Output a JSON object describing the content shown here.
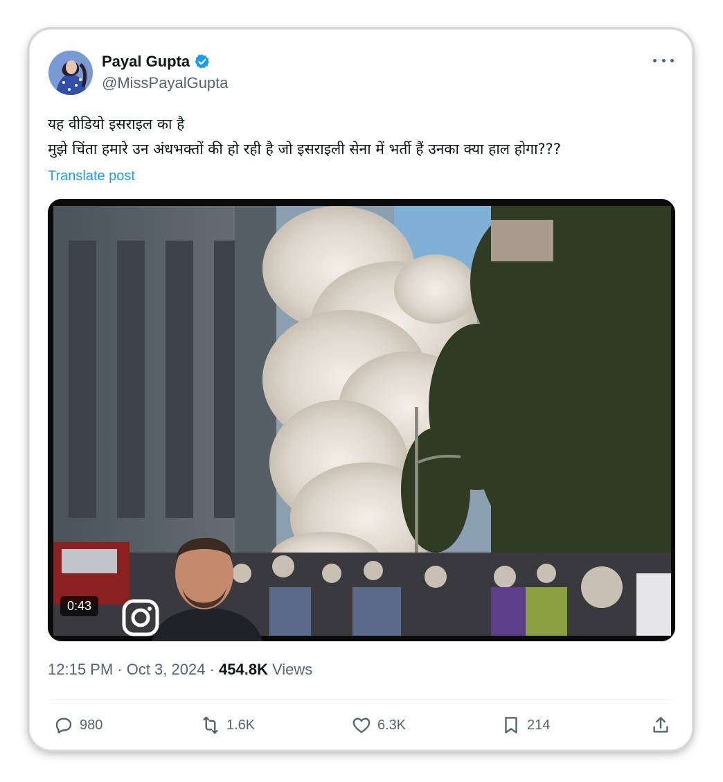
{
  "post": {
    "author": {
      "display_name": "Payal Gupta",
      "handle": "@MissPayalGupta",
      "verified": true
    },
    "text_lines": [
      "यह वीडियो इसराइल का है",
      "मुझे चिंता हमारे उन अंधभक्तों की हो रही है जो इसराइली सेना में भर्ती हैं उनका क्या हाल होगा???"
    ],
    "translate_label": "Translate post",
    "video": {
      "duration": "0:43",
      "overlay_icon": "instagram-icon"
    },
    "timestamp": "12:15 PM · Oct 3, 2024 · ",
    "views_count": "454.8K",
    "views_label": "Views",
    "stats": {
      "replies": "980",
      "reposts": "1.6K",
      "likes": "6.3K",
      "bookmarks": "214"
    }
  },
  "colors": {
    "accent": "#1d9bf0",
    "secondary_text": "#536471",
    "primary_text": "#0f1419"
  }
}
